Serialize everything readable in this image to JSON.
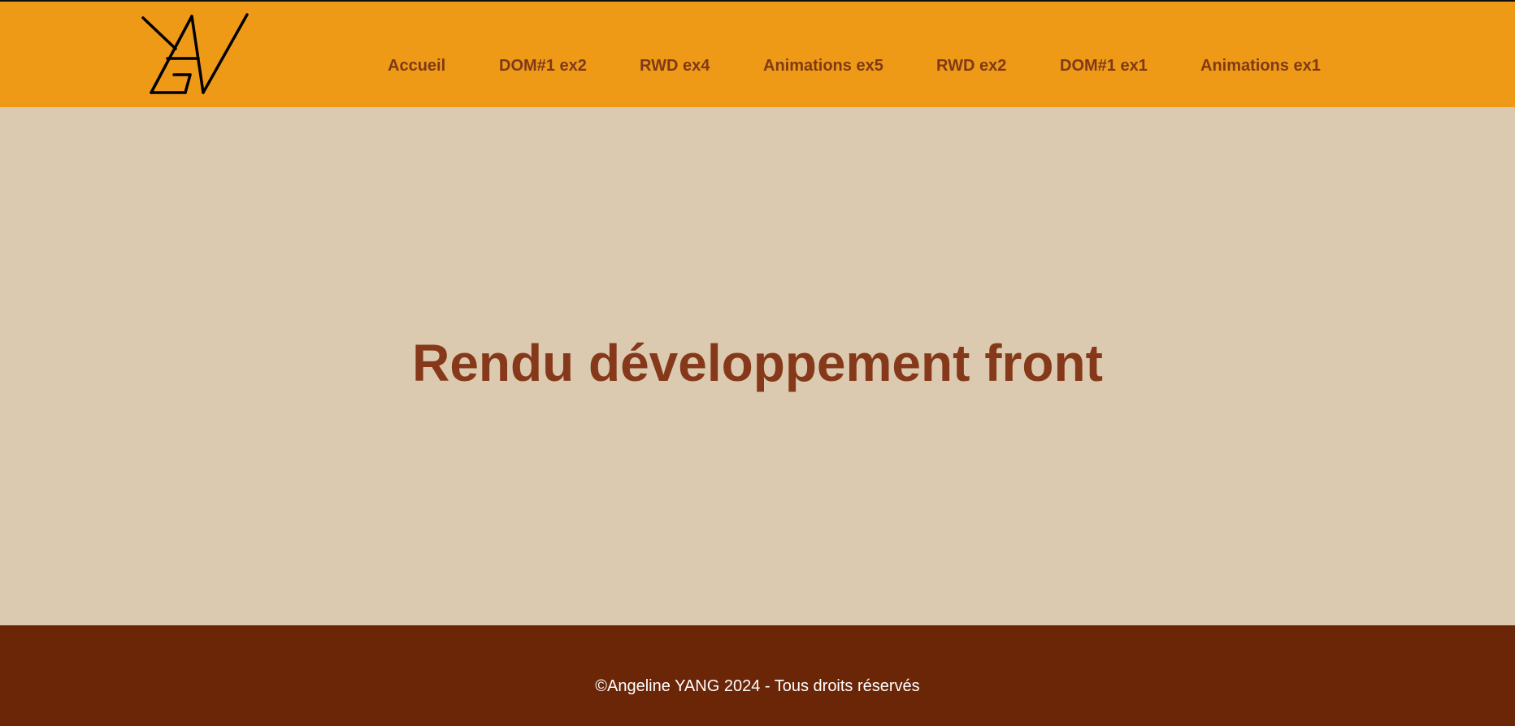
{
  "header": {
    "logo_icon": "yag-monogram-logo",
    "background_color": "#ef9a17",
    "nav": [
      {
        "label": "Accueil"
      },
      {
        "label": "DOM#1 ex2"
      },
      {
        "label": "RWD ex4"
      },
      {
        "label": "Animations ex5"
      },
      {
        "label": "RWD ex2"
      },
      {
        "label": "DOM#1 ex1"
      },
      {
        "label": "Animations ex1"
      }
    ]
  },
  "main": {
    "title": "Rendu développement front",
    "background_color": "#dbcab0",
    "title_color": "#86391a"
  },
  "footer": {
    "copyright": "©Angeline YANG 2024 - Tous droits réservés",
    "background_color": "#6b2507"
  }
}
